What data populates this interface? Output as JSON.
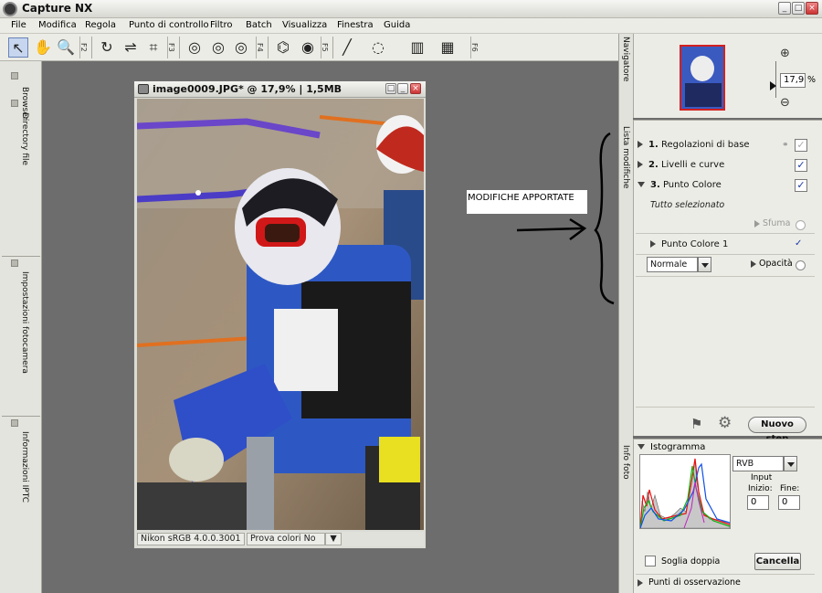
{
  "window": {
    "title": "Capture NX",
    "min_glyph": "_",
    "max_glyph": "□",
    "close_glyph": "×"
  },
  "menu": [
    "File",
    "Modifica",
    "Regola",
    "Punto di controllo",
    "Filtro",
    "Batch",
    "Visualizza",
    "Finestra",
    "Guida"
  ],
  "toolbar": {
    "groups": [
      "F2",
      "F3",
      "F4",
      "F5",
      "F6"
    ]
  },
  "left_panel": {
    "tabs": [
      "Browser",
      "Directory file",
      "Impostazioni fotocamera",
      "Informazioni IPTC"
    ]
  },
  "document": {
    "title": "image0009.JPG* @ 17,9% | 1,5MB",
    "profile": "Nikon sRGB 4.0.0.3001",
    "proof": "Prova colori No"
  },
  "annotation": {
    "label": "MODIFICHE APPORTATE"
  },
  "navigator": {
    "tab": "Navigatore",
    "zoom": "17,9",
    "unit": "%"
  },
  "edit_list": {
    "tab": "Lista modifiche",
    "steps": [
      {
        "num": "1.",
        "label": "Regolazioni di base",
        "checked": true
      },
      {
        "num": "2.",
        "label": "Livelli e curve",
        "checked": true
      },
      {
        "num": "3.",
        "label": "Punto Colore",
        "checked": true
      }
    ],
    "selection": "Tutto selezionato",
    "feather": "Sfuma",
    "point": "Punto Colore 1",
    "blend": "Normale",
    "opacity": "Opacità",
    "new_step": "Nuovo step"
  },
  "histogram": {
    "tab": "Info foto",
    "title": "Istogramma",
    "channel": "RVB",
    "input_label": "Input",
    "start_label": "Inizio:",
    "end_label": "Fine:",
    "start": "0",
    "end": "0",
    "double_threshold": "Soglia doppia",
    "cancel": "Cancella",
    "watch_points": "Punti di osservazione"
  },
  "colors": {
    "accent_check": "#1a3aa8",
    "workspace": "#6d6d6d",
    "selection_red": "#d42020"
  }
}
